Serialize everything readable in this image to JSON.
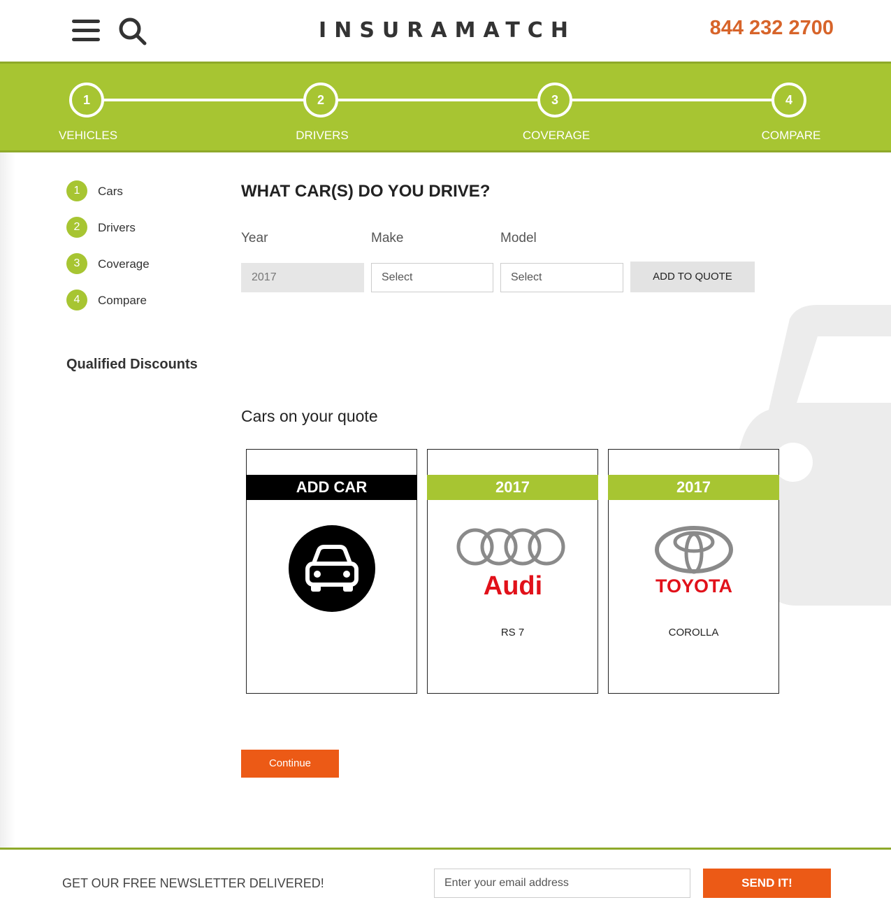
{
  "header": {
    "logo": "INSURAMATCH",
    "phone": "844 232 2700"
  },
  "progress": {
    "steps": [
      {
        "num": "1",
        "label": "VEHICLES"
      },
      {
        "num": "2",
        "label": "DRIVERS"
      },
      {
        "num": "3",
        "label": "COVERAGE"
      },
      {
        "num": "4",
        "label": "COMPARE"
      }
    ]
  },
  "sidebar": {
    "items": [
      {
        "num": "1",
        "label": "Cars"
      },
      {
        "num": "2",
        "label": "Drivers"
      },
      {
        "num": "3",
        "label": "Coverage"
      },
      {
        "num": "4",
        "label": "Compare"
      }
    ],
    "discounts_heading": "Qualified Discounts"
  },
  "form": {
    "title": "WHAT CAR(S) DO YOU DRIVE?",
    "year_label": "Year",
    "make_label": "Make",
    "model_label": "Model",
    "year_value": "2017",
    "make_value": "Select",
    "model_value": "Select",
    "add_button": "ADD TO QUOTE"
  },
  "quote": {
    "heading": "Cars on your quote",
    "add_card_label": "ADD CAR",
    "cars": [
      {
        "year": "2017",
        "brand": "Audi",
        "model": "RS 7"
      },
      {
        "year": "2017",
        "brand": "TOYOTA",
        "model": "COROLLA"
      }
    ],
    "continue_label": "Continue"
  },
  "footer": {
    "newsletter_text": "GET OUR FREE NEWSLETTER DELIVERED!",
    "email_placeholder": "Enter your email address",
    "send_label": "SEND IT!"
  },
  "colors": {
    "brand_green": "#a7c532",
    "accent_orange": "#ec5a16",
    "phone_orange": "#d7642a"
  }
}
